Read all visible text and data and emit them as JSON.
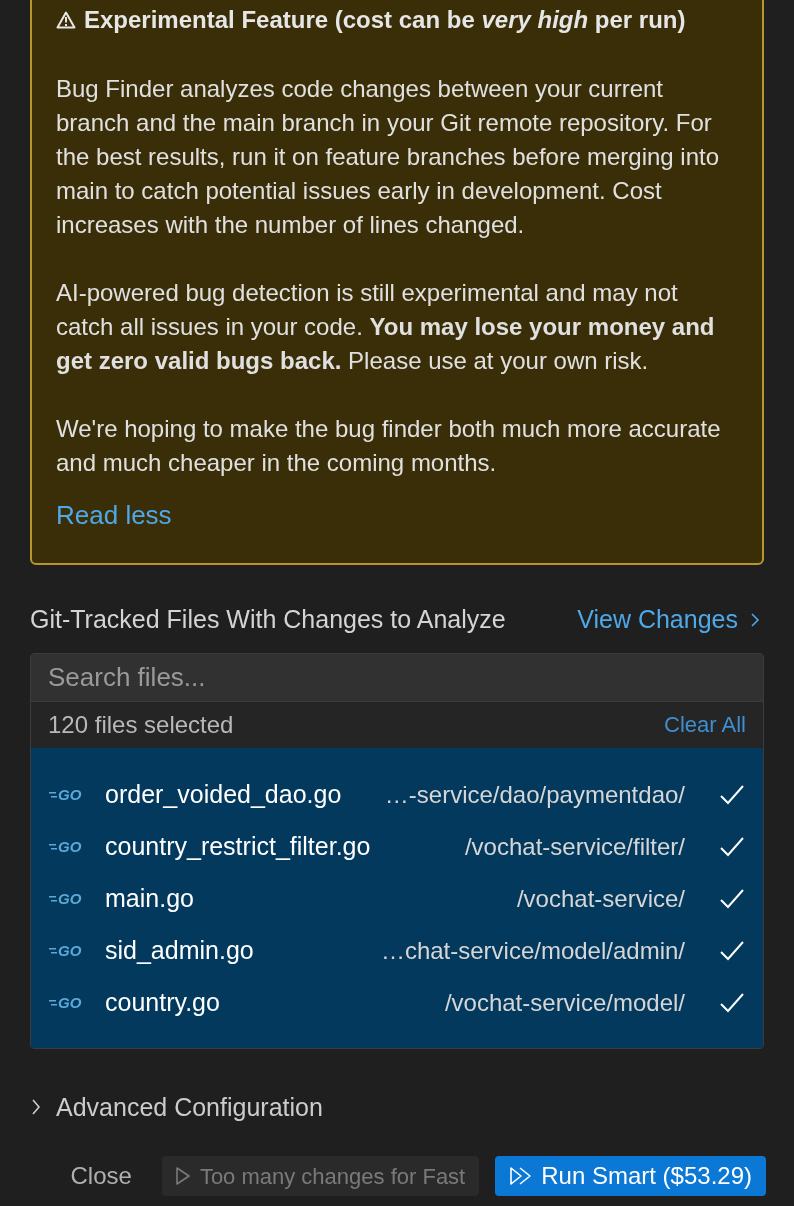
{
  "warning": {
    "title": "Experimental Feature (cost can be *very high* per run)",
    "paragraphs": [
      "Bug Finder analyzes code changes between your current branch and the main branch in your Git remote repository. For the best results, run it on feature branches before merging into main to catch potential issues early in development. Cost increases with the number of lines changed.",
      "AI-powered bug detection is still experimental and may not catch all issues in your code. **You may lose your money and get zero valid bugs back.** Please use at your own risk.",
      "We're hoping to make the bug finder both much more accurate and much cheaper in the coming months."
    ],
    "toggle_link": "Read less"
  },
  "files_section": {
    "title": "Git-Tracked Files With Changes to Analyze",
    "view_changes": "View Changes",
    "search": {
      "placeholder": "Search files..."
    },
    "selected_count": "120 files selected",
    "clear_all": "Clear All",
    "files": [
      {
        "icon_label": "GO",
        "name": "order_voided_dao.go",
        "path": "…-service/dao/paymentdao/",
        "selected": true
      },
      {
        "icon_label": "GO",
        "name": "country_restrict_filter.go",
        "path": "/vochat-service/filter/",
        "selected": true
      },
      {
        "icon_label": "GO",
        "name": "main.go",
        "path": "/vochat-service/",
        "selected": true
      },
      {
        "icon_label": "GO",
        "name": "sid_admin.go",
        "path": "…chat-service/model/admin/",
        "selected": true
      },
      {
        "icon_label": "GO",
        "name": "country.go",
        "path": "/vochat-service/model/",
        "selected": true
      }
    ]
  },
  "advanced": {
    "label": "Advanced Configuration",
    "expanded": false
  },
  "buttons": {
    "close": "Close",
    "fast": "Too many changes for Fast",
    "smart": "Run Smart ($53.29)"
  }
}
